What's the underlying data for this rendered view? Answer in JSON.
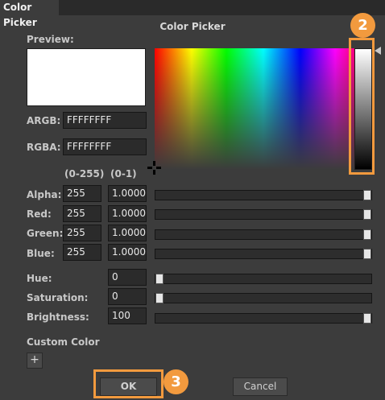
{
  "window": {
    "tab_title": "Color Picker",
    "dialog_title": "Color Picker"
  },
  "preview": {
    "label": "Preview:",
    "color": "#ffffff"
  },
  "argb": {
    "label": "ARGB:",
    "value": "FFFFFFFF"
  },
  "rgba": {
    "label": "RGBA:",
    "value": "FFFFFFFF"
  },
  "range_headers": {
    "int_range": "(0-255)",
    "float_range": "(0-1)"
  },
  "channels": [
    {
      "label": "Alpha:",
      "int_value": "255",
      "float_value": "1.0000",
      "slider_fraction": 1.0
    },
    {
      "label": "Red:",
      "int_value": "255",
      "float_value": "1.0000",
      "slider_fraction": 1.0
    },
    {
      "label": "Green:",
      "int_value": "255",
      "float_value": "1.0000",
      "slider_fraction": 1.0
    },
    {
      "label": "Blue:",
      "int_value": "255",
      "float_value": "1.0000",
      "slider_fraction": 1.0
    }
  ],
  "hsb": [
    {
      "label": "Hue:",
      "value": "0",
      "slider_fraction": 0.0
    },
    {
      "label": "Saturation:",
      "value": "0",
      "slider_fraction": 0.0
    },
    {
      "label": "Brightness:",
      "value": "100",
      "slider_fraction": 1.0
    }
  ],
  "custom_color": {
    "label": "Custom Color",
    "add_label": "+"
  },
  "buttons": {
    "ok": "OK",
    "cancel": "Cancel"
  },
  "annotations": {
    "brightness_badge": "2",
    "ok_badge": "3",
    "highlight_color": "#f29a3e"
  }
}
